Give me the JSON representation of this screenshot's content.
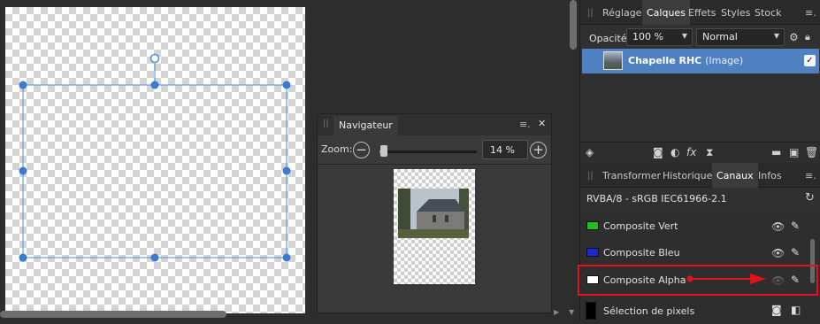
{
  "navigator": {
    "title": "Navigateur",
    "zoom_label": "Zoom:",
    "zoom_value": "14 %",
    "zoom_fraction": 0.14
  },
  "layers_panel": {
    "tabs": [
      "Réglage",
      "Calques",
      "Effets",
      "Styles",
      "Stock"
    ],
    "active_tab": "Calques",
    "opacity_label": "Opacité:",
    "opacity_value": "100 %",
    "blend_mode": "Normal",
    "layer": {
      "name": "Chapelle RHC",
      "type": "(Image)",
      "visible": true
    }
  },
  "channels_panel": {
    "tabs": [
      "Transformer",
      "Historique",
      "Canaux",
      "Infos"
    ],
    "active_tab": "Canaux",
    "profile": "RVBA/8 - sRGB IEC61966-2.1",
    "channels": [
      {
        "label": "Composite Vert",
        "color": "#1fbf1f"
      },
      {
        "label": "Composite Bleu",
        "color": "#1a28d0"
      },
      {
        "label": "Composite Alpha",
        "color": "#ffffff"
      },
      {
        "label": "Sélection de pixels",
        "color": "#000000"
      }
    ]
  },
  "colors": {
    "selection_blue": "#4a90d9",
    "highlight_red": "#e0141b",
    "layer_selected": "#4f81c2"
  }
}
